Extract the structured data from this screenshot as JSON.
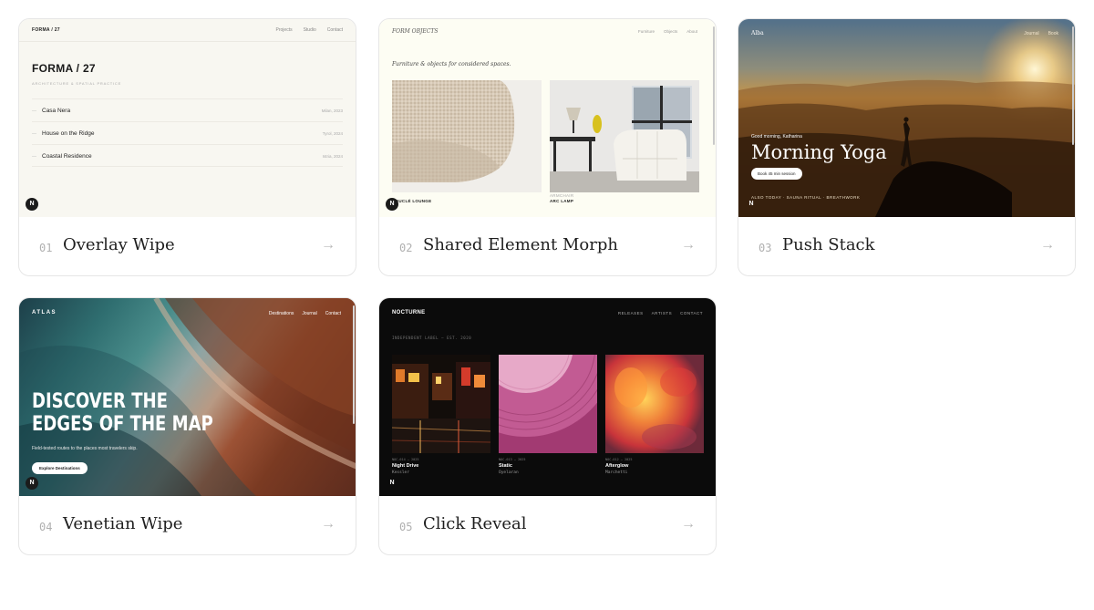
{
  "cards": [
    {
      "number": "01",
      "title": "Overlay Wipe",
      "arrow": "→",
      "preview": {
        "logo": "FORMA / 27",
        "nav": [
          "Projects",
          "Studio",
          "Contact"
        ],
        "heading": "FORMA / 27",
        "subtitle": "ARCHITECTURE & SPATIAL PRACTICE",
        "projects": [
          {
            "name": "Casa Nera",
            "meta": "Milan, 2023"
          },
          {
            "name": "House on the Ridge",
            "meta": "Tyrol, 2024"
          },
          {
            "name": "Coastal Residence",
            "meta": "Istria, 2024"
          }
        ],
        "badge": "N"
      }
    },
    {
      "number": "02",
      "title": "Shared Element Morph",
      "arrow": "→",
      "preview": {
        "logo": "FORM OBJECTS",
        "nav": [
          "Furniture",
          "Objects",
          "About"
        ],
        "tagline": "Furniture & objects for considered spaces.",
        "captions": [
          "BOUCLÉ LOUNGE",
          "ARMCHAIR",
          "ARC LAMP"
        ],
        "badge": "N"
      }
    },
    {
      "number": "03",
      "title": "Push Stack",
      "arrow": "→",
      "preview": {
        "logo": "Alba",
        "nav": [
          "Journal",
          "Book"
        ],
        "greeting": "Good morning, Katharina",
        "heading": "Morning Yoga",
        "button": "Book 45 min session",
        "also": "ALSO TODAY · SAUNA RITUAL · BREATHWORK",
        "badge": "N"
      }
    },
    {
      "number": "04",
      "title": "Venetian Wipe",
      "arrow": "→",
      "preview": {
        "logo": "ATLAS",
        "nav": [
          "Destinations",
          "Journal",
          "Contact"
        ],
        "heading": "DISCOVER THE EDGES OF THE MAP",
        "description": "Field-tested routes to the places most travelers skip.",
        "button": "Explore Destinations",
        "badge": "N"
      }
    },
    {
      "number": "05",
      "title": "Click Reveal",
      "arrow": "→",
      "preview": {
        "logo": "NOCTURNE",
        "nav": [
          "RELEASES",
          "ARTISTS",
          "CONTACT"
        ],
        "tagline": "INDEPENDENT LABEL — EST. 2020",
        "releases": [
          {
            "meta": "NOC-014 — 2025",
            "name": "Night Drive",
            "artist": "Kessler"
          },
          {
            "meta": "NOC-013 — 2025",
            "name": "Static",
            "artist": "Oyelaran"
          },
          {
            "meta": "NOC-012 — 2025",
            "name": "Afterglow",
            "artist": "Marchetti"
          }
        ],
        "badge": "N"
      }
    }
  ]
}
